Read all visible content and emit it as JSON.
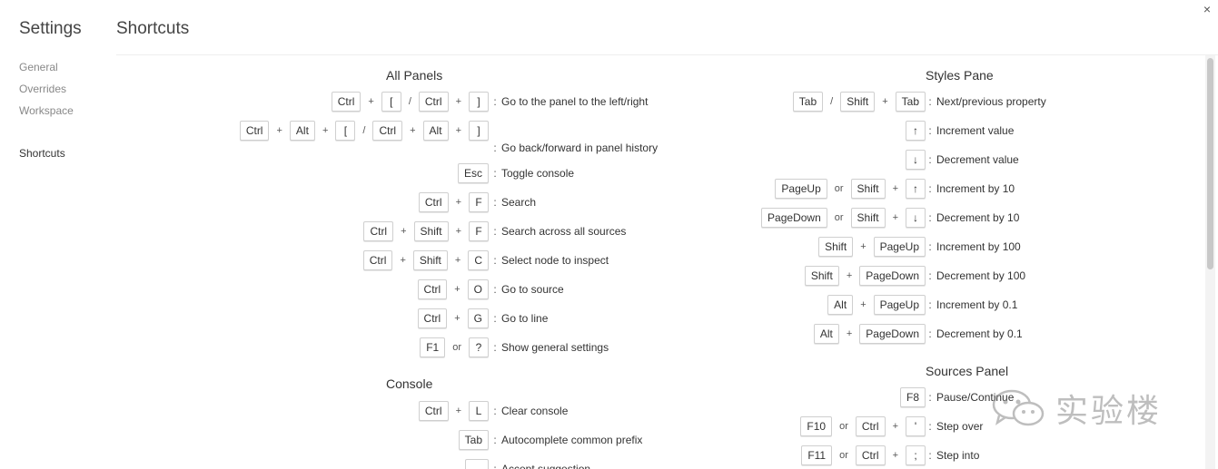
{
  "sidebar": {
    "title": "Settings",
    "items": [
      {
        "label": "General"
      },
      {
        "label": "Overrides"
      },
      {
        "label": "Workspace"
      },
      {
        "label": "Shortcuts"
      }
    ]
  },
  "page": {
    "title": "Shortcuts",
    "close_icon": "×"
  },
  "left": {
    "sections": [
      {
        "title": "All Panels",
        "rows": [
          {
            "keys": [
              "Ctrl",
              "+",
              "[",
              "/",
              "Ctrl",
              "+",
              "]"
            ],
            "desc": "Go to the panel to the left/right"
          },
          {
            "keys": [
              "Ctrl",
              "+",
              "Alt",
              "+",
              "[",
              "/",
              "Ctrl",
              "+",
              "Alt",
              "+",
              "]"
            ],
            "desc": "Go back/forward in panel history"
          },
          {
            "keys": [
              "Esc"
            ],
            "desc": "Toggle console"
          },
          {
            "keys": [
              "Ctrl",
              "+",
              "F"
            ],
            "desc": "Search"
          },
          {
            "keys": [
              "Ctrl",
              "+",
              "Shift",
              "+",
              "F"
            ],
            "desc": "Search across all sources"
          },
          {
            "keys": [
              "Ctrl",
              "+",
              "Shift",
              "+",
              "C"
            ],
            "desc": "Select node to inspect"
          },
          {
            "keys": [
              "Ctrl",
              "+",
              "O"
            ],
            "desc": "Go to source"
          },
          {
            "keys": [
              "Ctrl",
              "+",
              "G"
            ],
            "desc": "Go to line"
          },
          {
            "keys": [
              "F1",
              "or",
              "?"
            ],
            "desc": "Show general settings"
          }
        ]
      },
      {
        "title": "Console",
        "rows": [
          {
            "keys": [
              "Ctrl",
              "+",
              "L"
            ],
            "desc": "Clear console"
          },
          {
            "keys": [
              "Tab"
            ],
            "desc": "Autocomplete common prefix"
          },
          {
            "keys": [
              "→"
            ],
            "desc": "Accept suggestion"
          }
        ]
      }
    ]
  },
  "right": {
    "sections": [
      {
        "title": "Styles Pane",
        "rows": [
          {
            "keys": [
              "Tab",
              "/",
              "Shift",
              "+",
              "Tab"
            ],
            "desc": "Next/previous property"
          },
          {
            "keys": [
              "↑"
            ],
            "desc": "Increment value"
          },
          {
            "keys": [
              "↓"
            ],
            "desc": "Decrement value"
          },
          {
            "keys": [
              "PageUp",
              "or",
              "Shift",
              "+",
              "↑"
            ],
            "desc": "Increment by 10"
          },
          {
            "keys": [
              "PageDown",
              "or",
              "Shift",
              "+",
              "↓"
            ],
            "desc": "Decrement by 10"
          },
          {
            "keys": [
              "Shift",
              "+",
              "PageUp"
            ],
            "desc": "Increment by 100"
          },
          {
            "keys": [
              "Shift",
              "+",
              "PageDown"
            ],
            "desc": "Decrement by 100"
          },
          {
            "keys": [
              "Alt",
              "+",
              "PageUp"
            ],
            "desc": "Increment by 0.1"
          },
          {
            "keys": [
              "Alt",
              "+",
              "PageDown"
            ],
            "desc": "Decrement by 0.1"
          }
        ]
      },
      {
        "title": "Sources Panel",
        "rows": [
          {
            "keys": [
              "F8"
            ],
            "desc": "Pause/Continue"
          },
          {
            "keys": [
              "F10",
              "or",
              "Ctrl",
              "+",
              "'"
            ],
            "desc": "Step over"
          },
          {
            "keys": [
              "F11",
              "or",
              "Ctrl",
              "+",
              ";"
            ],
            "desc": "Step into"
          }
        ]
      }
    ]
  },
  "watermark": {
    "icon": "wechat-logo-icon",
    "text": "实验楼"
  }
}
